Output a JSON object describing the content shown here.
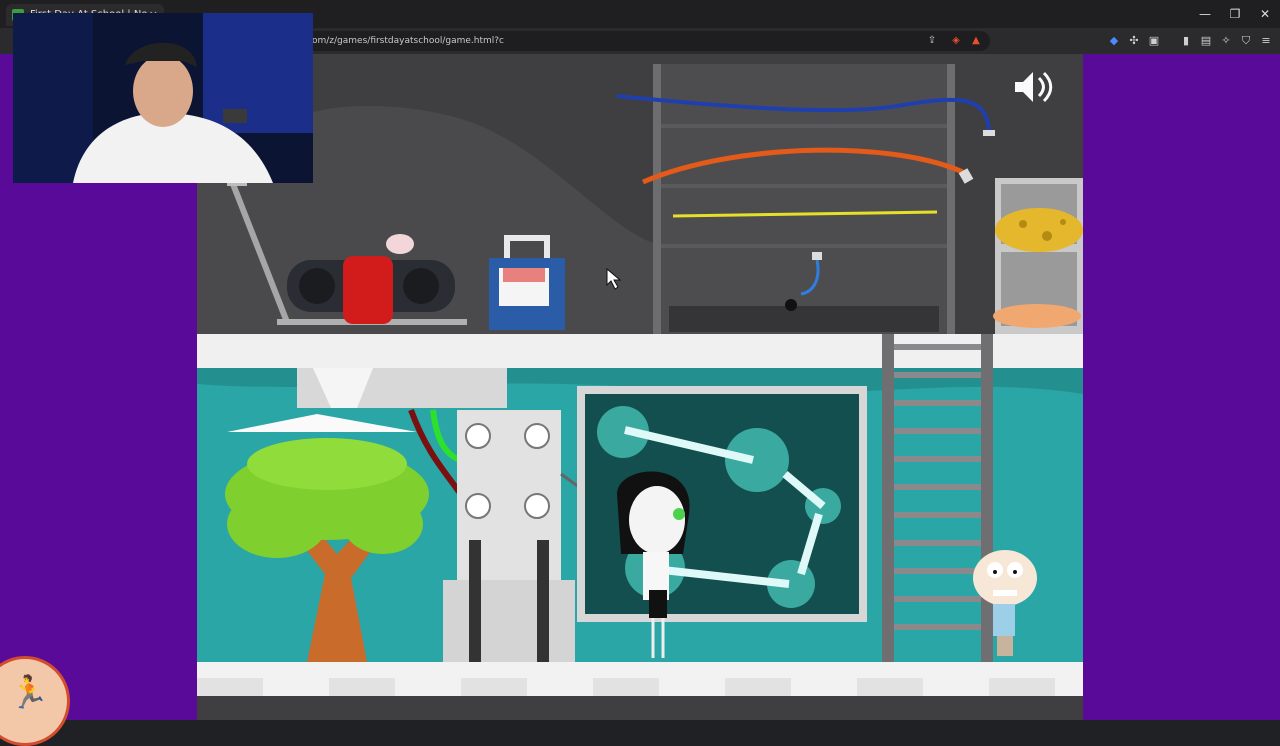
{
  "browser": {
    "tab_title": "First Day At School | No Ads",
    "tab_close": "×",
    "url": "om/z/games/firstdayatschool/game.html?c",
    "window_controls": {
      "minimize": "—",
      "maximize": "❐",
      "close": "✕"
    }
  },
  "icons": {
    "favicon": "game-favicon-icon",
    "sound": "speaker-volume-icon",
    "cursor": "mouse-pointer-icon",
    "corner_badge": "running-person-icon"
  },
  "colors": {
    "page_background": "#5a0a99",
    "wall_teal": "#2aa6a6",
    "floor_white": "#f2f2f2",
    "blue_wire": "#1f3fae",
    "orange_wire": "#e45a18",
    "yellow_wire": "#e6e02a",
    "green_tree": "#7fcf2e",
    "red_button": "#d21b1b"
  }
}
